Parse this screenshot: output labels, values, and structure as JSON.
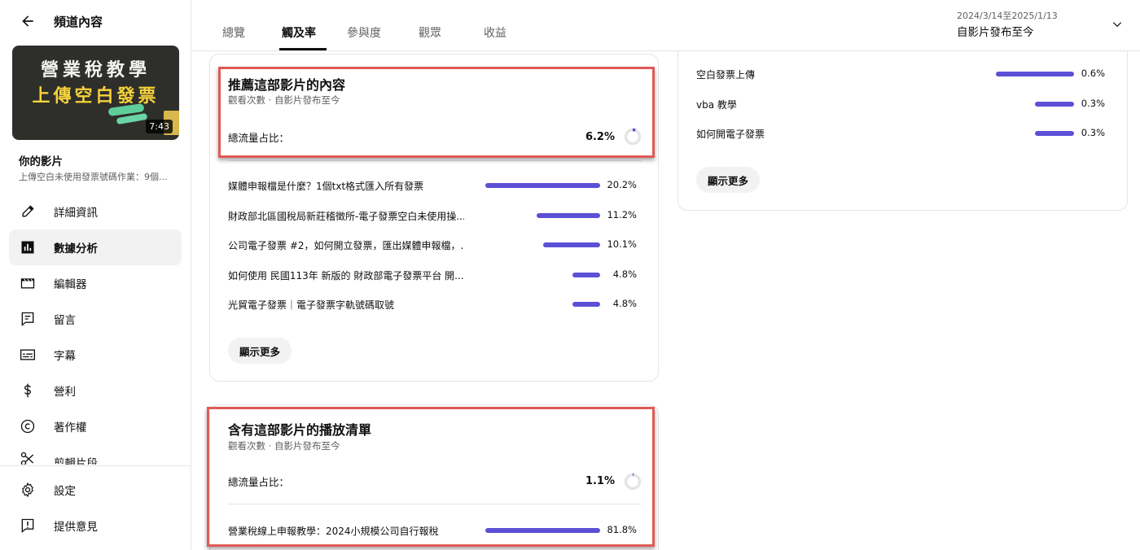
{
  "sidebar": {
    "title": "頻道內容",
    "thumbnail": {
      "line1": "營業稅教學",
      "line2": "上傳空白發票",
      "duration": "7:43"
    },
    "your_video_label": "你的影片",
    "video_subtitle": "上傳空白未使用發票號碼作業：9個...",
    "nav": [
      {
        "label": "詳細資訊",
        "icon": "pencil-icon"
      },
      {
        "label": "數據分析",
        "icon": "analytics-icon",
        "active": true
      },
      {
        "label": "編輯器",
        "icon": "clapperboard-icon"
      },
      {
        "label": "留言",
        "icon": "comment-icon"
      },
      {
        "label": "字幕",
        "icon": "subtitles-icon"
      },
      {
        "label": "營利",
        "icon": "dollar-icon"
      },
      {
        "label": "著作權",
        "icon": "copyright-icon"
      },
      {
        "label": "剪輯片段",
        "icon": "scissors-icon"
      }
    ],
    "bottom_nav": [
      {
        "label": "設定",
        "icon": "gear-icon"
      },
      {
        "label": "提供意見",
        "icon": "feedback-icon"
      }
    ]
  },
  "header": {
    "tabs": [
      "總覽",
      "觸及率",
      "參與度",
      "觀眾",
      "收益"
    ],
    "active_tab": "觸及率",
    "date_range": "2024/3/14至2025/1/13",
    "date_label": "自影片發布至今"
  },
  "card_recommend": {
    "title": "推薦這部影片的內容",
    "subtitle": "觀看次數 · 自影片發布至今",
    "share_label": "總流量占比：",
    "share_value": "6.2%",
    "share_fraction": 0.062,
    "rows": [
      {
        "label": "媒體申報檔是什麼？1個txt格式匯入所有發票",
        "pct": "20.2%",
        "value": 20.2
      },
      {
        "label": "財政部北區國稅局新莊稽徵所-電子發票空白未使用操...",
        "pct": "11.2%",
        "value": 11.2
      },
      {
        "label": "公司電子發票 #2，如何開立發票，匯出媒體申報檔，...",
        "pct": "10.1%",
        "value": 10.1
      },
      {
        "label": "如何使用 民國113年 新版的 財政部電子發票平台 開...",
        "pct": "4.8%",
        "value": 4.8
      },
      {
        "label": "光貿電子發票｜電子發票字軌號碼取號",
        "pct": "4.8%",
        "value": 4.8
      }
    ],
    "more_label": "顯示更多"
  },
  "card_playlist": {
    "title": "含有這部影片的播放清單",
    "subtitle": "觀看次數 · 自影片發布至今",
    "share_label": "總流量占比：",
    "share_value": "1.1%",
    "share_fraction": 0.011,
    "rows": [
      {
        "label": "營業稅線上申報教學：2024小規模公司自行報稅",
        "pct": "81.8%",
        "value": 81.8
      }
    ]
  },
  "card_search": {
    "rows": [
      {
        "label": "空白發票上傳",
        "pct": "0.6%",
        "value": 0.6
      },
      {
        "label": "vba 教學",
        "pct": "0.3%",
        "value": 0.3
      },
      {
        "label": "如何開電子發票",
        "pct": "0.3%",
        "value": 0.3
      }
    ],
    "more_label": "顯示更多"
  },
  "colors": {
    "bar": "#5b50d6",
    "highlight": "#e05a57",
    "donut_track": "#e5e5e5"
  }
}
